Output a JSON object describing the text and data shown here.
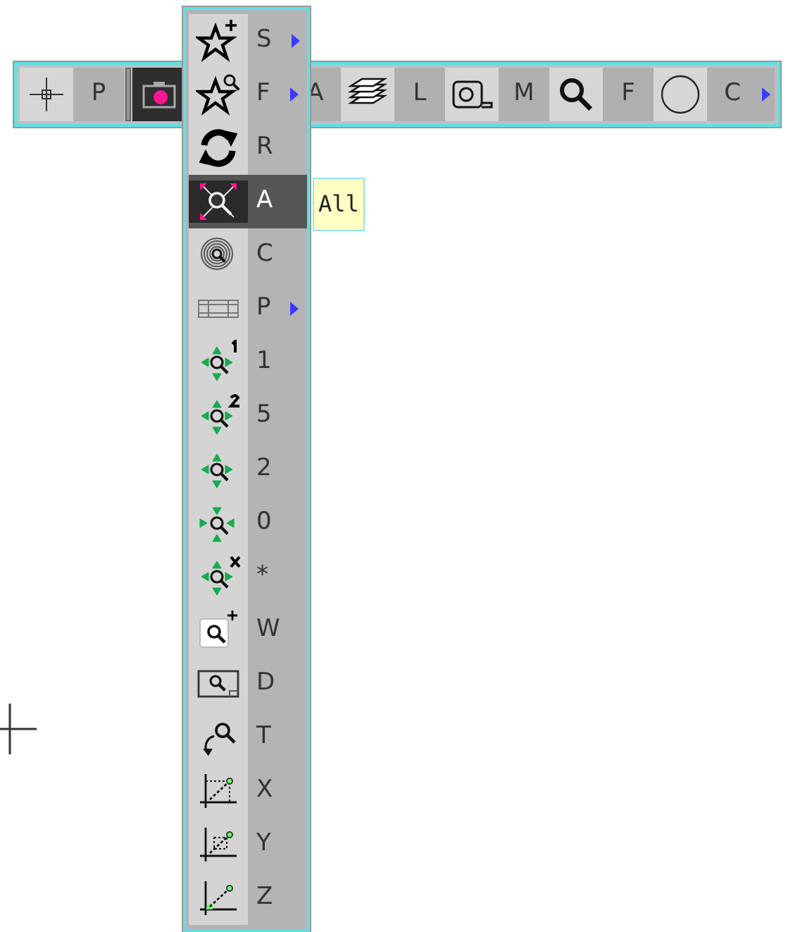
{
  "toolbar": {
    "items": [
      {
        "kind": "crosshair",
        "label": "P",
        "selected": false
      },
      {
        "kind": "camera",
        "selected": true
      },
      {
        "kind": "hidden",
        "label": "A",
        "selected": false
      },
      {
        "kind": "layers",
        "label": "L",
        "selected": false
      },
      {
        "kind": "tape",
        "label": "M",
        "selected": false
      },
      {
        "kind": "magnifier",
        "label": "F",
        "selected": false
      },
      {
        "kind": "circle",
        "label": "C",
        "selected": false
      }
    ],
    "more": true
  },
  "menu": {
    "items": [
      {
        "kind": "star-plus",
        "label": "S",
        "submenu": true,
        "selected": false
      },
      {
        "kind": "star-search",
        "label": "F",
        "submenu": true,
        "selected": false
      },
      {
        "kind": "refresh",
        "label": "R",
        "submenu": false,
        "selected": false
      },
      {
        "kind": "zoom-all",
        "label": "A",
        "submenu": false,
        "selected": true
      },
      {
        "kind": "target",
        "label": "C",
        "submenu": false,
        "selected": false
      },
      {
        "kind": "panel",
        "label": "P",
        "submenu": true,
        "selected": false
      },
      {
        "kind": "pan-1",
        "label": "1",
        "submenu": false,
        "selected": false
      },
      {
        "kind": "pan-2",
        "label": "5",
        "submenu": false,
        "selected": false
      },
      {
        "kind": "pan",
        "label": "2",
        "submenu": false,
        "selected": false
      },
      {
        "kind": "pan-in",
        "label": "0",
        "submenu": false,
        "selected": false
      },
      {
        "kind": "pan-x",
        "label": "*",
        "submenu": false,
        "selected": false
      },
      {
        "kind": "zoom-window",
        "label": "W",
        "submenu": false,
        "selected": false
      },
      {
        "kind": "zoom-dynamic",
        "label": "D",
        "submenu": false,
        "selected": false
      },
      {
        "kind": "zoom-rotate",
        "label": "T",
        "submenu": false,
        "selected": false
      },
      {
        "kind": "axis-x",
        "label": "X",
        "submenu": false,
        "selected": false
      },
      {
        "kind": "axis-y",
        "label": "Y",
        "submenu": false,
        "selected": false
      },
      {
        "kind": "axis-z",
        "label": "Z",
        "submenu": false,
        "selected": false
      }
    ]
  },
  "tooltip": {
    "text": "All"
  }
}
